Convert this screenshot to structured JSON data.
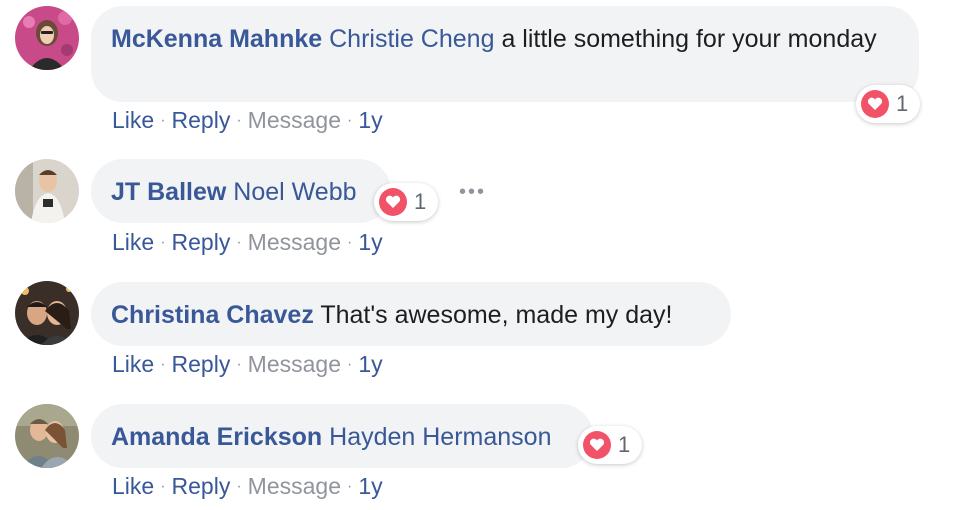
{
  "actions": {
    "like": "Like",
    "reply": "Reply",
    "message": "Message",
    "sep": "·"
  },
  "comments": [
    {
      "author": "McKenna Mahnke",
      "tag": "Christie Cheng",
      "text": "a little something for your monday",
      "time": "1y",
      "reaction": {
        "icon": "heart-icon",
        "count": "1"
      }
    },
    {
      "author": "JT Ballew",
      "tag": "Noel Webb",
      "text": "",
      "time": "1y",
      "reaction": {
        "icon": "heart-icon",
        "count": "1"
      },
      "more": "•••"
    },
    {
      "author": "Christina Chavez",
      "tag": "",
      "text": "That's awesome, made my day!",
      "time": "1y"
    },
    {
      "author": "Amanda Erickson",
      "tag": "Hayden Hermanson",
      "text": "",
      "time": "1y",
      "reaction": {
        "icon": "heart-icon",
        "count": "1"
      }
    }
  ],
  "colors": {
    "link": "#385898",
    "muted": "#90949c",
    "bubble": "#f2f3f5",
    "heart": "#f25268"
  }
}
